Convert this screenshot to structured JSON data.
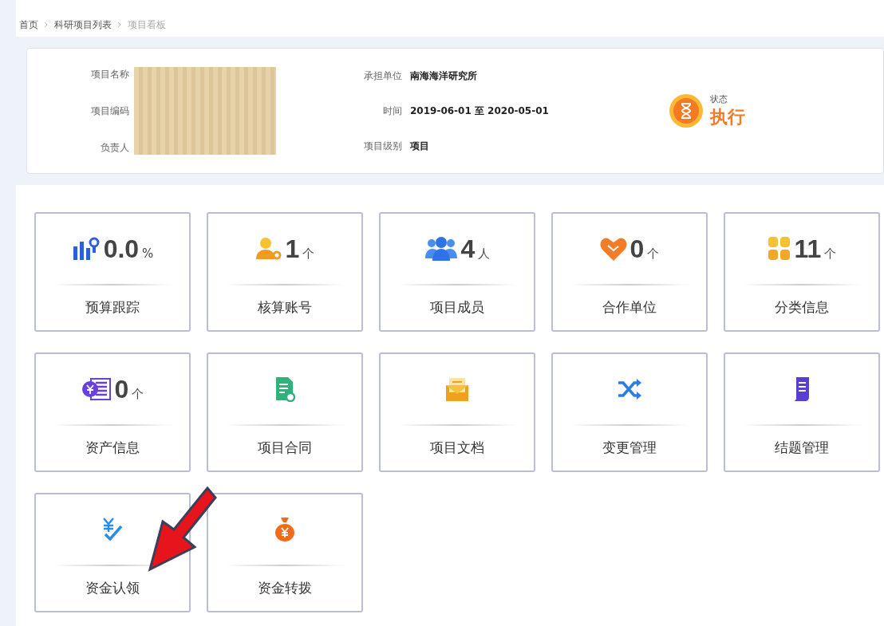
{
  "breadcrumb": [
    {
      "label": "首页",
      "current": false
    },
    {
      "label": "科研项目列表",
      "current": false
    },
    {
      "label": "项目看板",
      "current": true
    }
  ],
  "project": {
    "fields_left": [
      {
        "label": "项目名称"
      },
      {
        "label": "项目编码"
      },
      {
        "label": "负责人"
      }
    ],
    "fields_right": [
      {
        "label": "承担单位",
        "value": "南海海洋研究所"
      },
      {
        "label": "时间",
        "value": "2019-06-01 至 2020-05-01"
      },
      {
        "label": "项目级别",
        "value": "项目"
      }
    ],
    "status": {
      "label": "状态",
      "value": "执行"
    }
  },
  "tiles": [
    {
      "value": "0.0",
      "unit": "%",
      "label": "预算跟踪"
    },
    {
      "value": "1",
      "unit": "个",
      "label": "核算账号"
    },
    {
      "value": "4",
      "unit": "人",
      "label": "项目成员"
    },
    {
      "value": "0",
      "unit": "个",
      "label": "合作单位"
    },
    {
      "value": "11",
      "unit": "个",
      "label": "分类信息"
    },
    {
      "value": "0",
      "unit": "个",
      "label": "资产信息"
    },
    {
      "label": "项目合同"
    },
    {
      "label": "项目文档"
    },
    {
      "label": "变更管理"
    },
    {
      "label": "结题管理"
    },
    {
      "label": "资金认领"
    },
    {
      "label": "资金转拨"
    }
  ]
}
